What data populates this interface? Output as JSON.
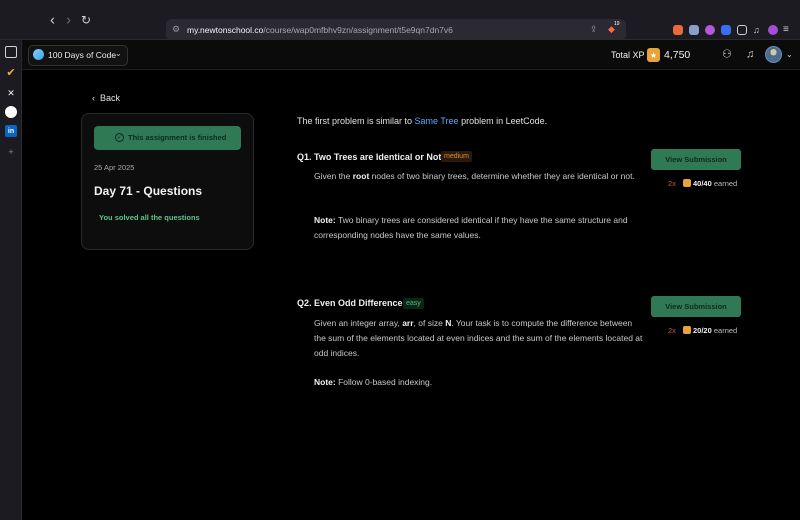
{
  "browser": {
    "url_host": "my.newtonschool.co",
    "url_path": "/course/wap0mfbhv9zn/assignment/t5e9qn7dn7v6",
    "extension_count": "19"
  },
  "header": {
    "course_name": "100 Days of Code",
    "xp_label": "Total XP",
    "xp_value": "4,750"
  },
  "sidebar_card": {
    "back_label": "Back",
    "status": "This assignment is finished",
    "date": "25 Apr 2025",
    "title": "Day 71 - Questions",
    "solved_text": "You solved all the questions"
  },
  "main": {
    "intro_prefix": "The first problem is similar to ",
    "intro_link": "Same Tree",
    "intro_suffix": " problem in LeetCode.",
    "questions": [
      {
        "number": "Q1.",
        "title": "Two Trees are Identical or Not",
        "difficulty": "medium",
        "body_1": "Given the ",
        "body_bold": "root",
        "body_2": " nodes of two binary trees, determine whether they are identical or not.",
        "note_label": "Note:",
        "note": " Two binary trees are considered identical if they have the same structure and corresponding nodes have the same values.",
        "button": "View Submission",
        "multiplier": "2x",
        "score": "40/40",
        "earned_label": "earned"
      },
      {
        "number": "Q2.",
        "title": "Even Odd Difference",
        "difficulty": "easy",
        "body_1": "Given an integer array, ",
        "body_bold": "arr",
        "body_2": ", of size ",
        "body_bold_2": "N",
        "body_3": ". Your task is to compute the difference between the sum of the elements located at even indices and the sum of the elements located at odd indices.",
        "note_label": "Note:",
        "note": " Follow 0-based indexing.",
        "button": "View Submission",
        "multiplier": "2x",
        "score": "20/20",
        "earned_label": "earned"
      }
    ]
  },
  "colors": {
    "accent_green": "#2f7a55",
    "link_blue": "#5aa9ff",
    "medium_orange": "#e68a3a",
    "easy_green": "#4fbf7f",
    "xp_gold": "#e8a33a"
  }
}
